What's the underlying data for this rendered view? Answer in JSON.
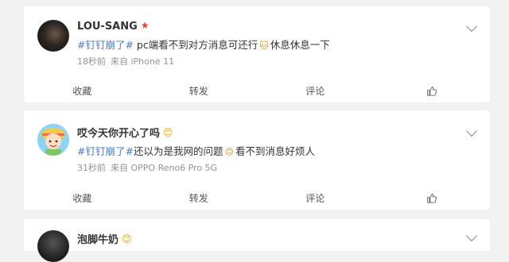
{
  "posts": [
    {
      "user": "LOU-SANG",
      "badge": "★",
      "text": {
        "topic": "#钉钉崩了#",
        "part1": " pc端看不到对方消息可还行",
        "emoji": "🐱",
        "part2": "休息休息一下"
      },
      "time": "18秒前",
      "source": "来自 iPhone 11",
      "actions": [
        "收藏",
        "转发",
        "评论"
      ]
    },
    {
      "user": "哎今天你开心了吗",
      "badge": "😊",
      "text": {
        "topic": "#钉钉崩了#",
        "part1": "还以为是我网的问题",
        "emoji": "🙃",
        "part2": "看不到消息好烦人"
      },
      "time": "31秒前",
      "source": "来自 OPPO Reno6 Pro 5G",
      "actions": [
        "收藏",
        "转发",
        "评论"
      ]
    },
    {
      "user": "泡脚牛奶",
      "badge": "😊"
    }
  ],
  "icons": {
    "more": "chevron-down-icon",
    "like": "thumbs-up-icon"
  },
  "colors": {
    "topic": "#4b79ba",
    "meta": "#939393",
    "background": "#f2f2f2"
  }
}
